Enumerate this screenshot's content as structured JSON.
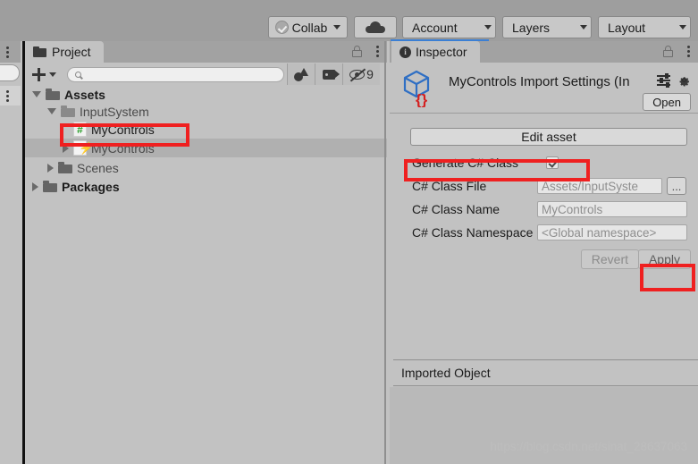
{
  "topbar": {
    "collab": {
      "label": "Collab",
      "icon": "collab-check-icon"
    },
    "cloud": {
      "icon": "cloud-icon"
    },
    "account": {
      "label": "Account"
    },
    "layers": {
      "label": "Layers"
    },
    "layout": {
      "label": "Layout"
    }
  },
  "project_panel": {
    "tab_label": "Project",
    "toolbar": {
      "create_label": "+",
      "search_placeholder": "",
      "search_value": "",
      "hidden_count": "9",
      "icons": [
        "shape-filter-icon",
        "tag-icon",
        "eye-off-icon"
      ]
    },
    "tree": [
      {
        "label": "Assets",
        "depth": 0,
        "arrow": "open",
        "icon": "folder-open-icon",
        "bold": true,
        "selected": false
      },
      {
        "label": "InputSystem",
        "depth": 1,
        "arrow": "open",
        "icon": "folder-open-icon",
        "bold": false,
        "selected": false
      },
      {
        "label": "MyControls",
        "depth": 2,
        "arrow": "none",
        "icon": "csharp-script-icon",
        "bold": false,
        "selected": false
      },
      {
        "label": "MyControls",
        "depth": 2,
        "arrow": "closed",
        "icon": "input-action-asset-icon",
        "bold": false,
        "selected": true
      },
      {
        "label": "Scenes",
        "depth": 1,
        "arrow": "closed",
        "icon": "folder-icon",
        "bold": false,
        "selected": false
      },
      {
        "label": "Packages",
        "depth": 0,
        "arrow": "closed",
        "icon": "folder-icon",
        "bold": true,
        "selected": false
      }
    ]
  },
  "inspector": {
    "tab_label": "Inspector",
    "title": "MyControls Import Settings (In",
    "asset_icon": "input-action-asset-cube-icon",
    "header_icons": [
      "preset-icon",
      "gear-icon"
    ],
    "open_button": "Open",
    "edit_asset_button": "Edit asset",
    "fields": {
      "generate_label": "Generate C# Class",
      "generate_checked": true,
      "class_file_label": "C# Class File",
      "class_file_value": "Assets/InputSyste",
      "browse_button": "...",
      "class_name_label": "C# Class Name",
      "class_name_value": "MyControls",
      "namespace_label": "C# Class Namespace",
      "namespace_value": "<Global namespace>"
    },
    "revert_button": "Revert",
    "apply_button": "Apply",
    "imported_object_label": "Imported Object"
  },
  "watermark": "https://blog.csdn.net/sinat_28637063",
  "colors": {
    "highlight_red": "#ef2020",
    "panel_bg": "#c2c2c2",
    "toolbar_bg": "#9e9e9e",
    "accent_blue": "#3b7fd4",
    "csharp_green": "#2ca02c",
    "input_blue": "#2aa3e0"
  }
}
